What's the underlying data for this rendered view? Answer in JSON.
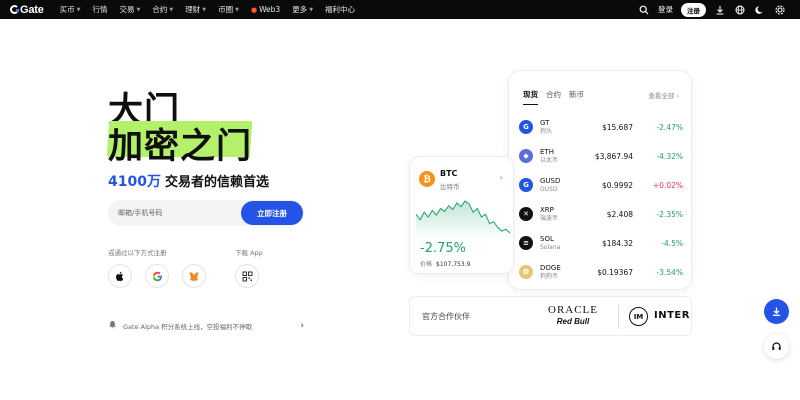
{
  "nav": {
    "logo": "Gate",
    "items": [
      {
        "label": "买币",
        "caret": true,
        "fire": false
      },
      {
        "label": "行情",
        "caret": false,
        "fire": false
      },
      {
        "label": "交易",
        "caret": true,
        "fire": false
      },
      {
        "label": "合约",
        "caret": true,
        "fire": false
      },
      {
        "label": "理财",
        "caret": true,
        "fire": false
      },
      {
        "label": "币圈",
        "caret": true,
        "fire": false
      },
      {
        "label": "Web3",
        "caret": false,
        "fire": true
      },
      {
        "label": "更多",
        "caret": true,
        "fire": false
      },
      {
        "label": "福利中心",
        "caret": false,
        "fire": false
      }
    ],
    "login": "登录",
    "register": "注册",
    "icons": [
      "search-icon",
      "download-icon",
      "globe-icon",
      "moon-icon",
      "settings-icon"
    ]
  },
  "hero": {
    "line1": "大门",
    "line2": "加密之门",
    "users_count": "4100万",
    "users_text": "交易者的信赖首选",
    "highlight_color": "#b5f06b",
    "accent_color": "#2354e6"
  },
  "signup": {
    "placeholder": "邮箱/手机号码",
    "button": "立即注册",
    "other_methods": "或通过以下方式注册",
    "download_app": "下载 App",
    "social_icons": [
      "apple-icon",
      "google-icon",
      "metamask-icon",
      "qrcode-icon"
    ]
  },
  "announcement": {
    "text": "Gate Alpha 积分系统上线，空投福利不停歇"
  },
  "market": {
    "tabs": [
      "现货",
      "合约",
      "新币"
    ],
    "active_tab": 0,
    "view_all": "查看全部",
    "coins": [
      {
        "symbol": "GT",
        "name": "狗头",
        "price": "$15.687",
        "change": "-2.47%",
        "direction": "down",
        "icon_color": "#2354e6",
        "icon": "gt-icon"
      },
      {
        "symbol": "ETH",
        "name": "以太币",
        "price": "$3,867.94",
        "change": "-4.32%",
        "direction": "down",
        "icon_color": "#5b6ee0",
        "icon": "eth-icon"
      },
      {
        "symbol": "GUSD",
        "name": "GUSD",
        "price": "$0.9992",
        "change": "+0.02%",
        "direction": "up",
        "icon_color": "#2354e6",
        "icon": "gusd-icon"
      },
      {
        "symbol": "XRP",
        "name": "瑞波币",
        "price": "$2.408",
        "change": "-2.35%",
        "direction": "down",
        "icon_color": "#111111",
        "icon": "xrp-icon"
      },
      {
        "symbol": "SOL",
        "name": "Solana",
        "price": "$184.32",
        "change": "-4.5%",
        "direction": "down",
        "icon_color": "#111111",
        "icon": "sol-icon"
      },
      {
        "symbol": "DOGE",
        "name": "狗狗币",
        "price": "$0.19367",
        "change": "-3.54%",
        "direction": "down",
        "icon_color": "#e8c770",
        "icon": "doge-icon"
      }
    ],
    "down_color": "#1aa36a",
    "up_color": "#e0364a"
  },
  "btc_card": {
    "symbol": "BTC",
    "name": "比特币",
    "change": "-2.75%",
    "price_label": "价格",
    "price": "$107,753.9",
    "sparkline": [
      58,
      52,
      60,
      55,
      62,
      57,
      64,
      61,
      67,
      63,
      70,
      66,
      72,
      69,
      60,
      64,
      55,
      58,
      48,
      50,
      44,
      40,
      42,
      38
    ]
  },
  "partners": {
    "label": "官方合作伙伴",
    "oracle_top": "ORACLE",
    "oracle_bottom": "Red Bull",
    "inter": "INTER"
  }
}
